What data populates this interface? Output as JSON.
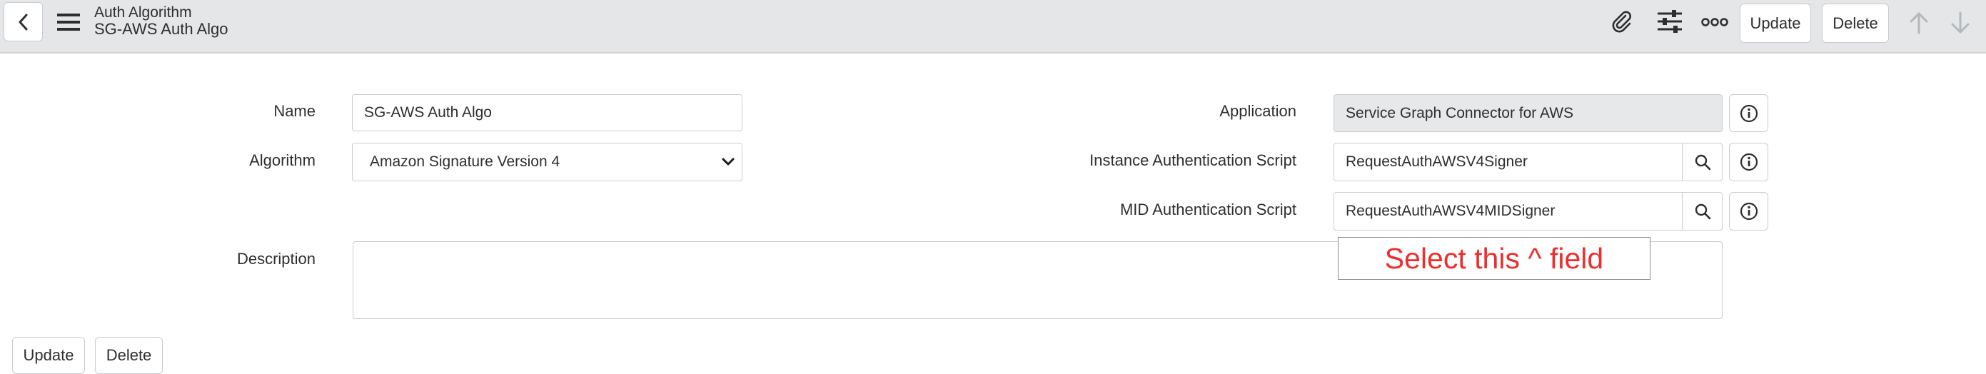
{
  "header": {
    "title": "Auth Algorithm",
    "subtitle": "SG-AWS Auth Algo",
    "update_label": "Update",
    "delete_label": "Delete"
  },
  "form": {
    "name_label": "Name",
    "name_value": "SG-AWS Auth Algo",
    "algorithm_label": "Algorithm",
    "algorithm_value": "Amazon Signature Version 4",
    "application_label": "Application",
    "application_value": "Service Graph Connector for AWS",
    "instance_script_label": "Instance Authentication Script",
    "instance_script_value": "RequestAuthAWSV4Signer",
    "mid_script_label": "MID Authentication Script",
    "mid_script_value": "RequestAuthAWSV4MIDSigner",
    "description_label": "Description",
    "description_value": ""
  },
  "annotation": {
    "text": "Select this ^ field",
    "color": "#ee2e2e"
  },
  "footer": {
    "update_label": "Update",
    "delete_label": "Delete"
  }
}
